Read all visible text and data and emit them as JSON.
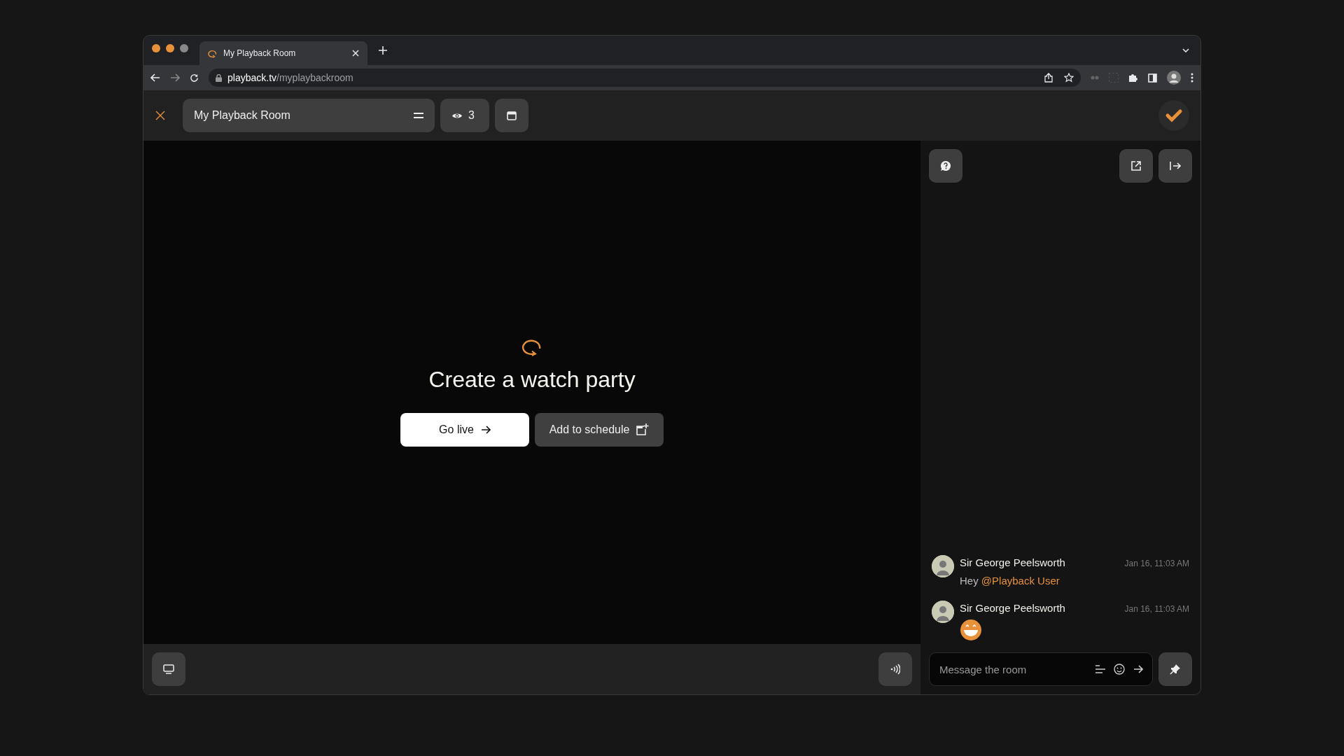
{
  "browser": {
    "tab_title": "My Playback Room",
    "url_domain": "playback.tv",
    "url_path": "/myplaybackroom"
  },
  "room": {
    "name": "My Playback Room",
    "viewers": "3"
  },
  "hero": {
    "title": "Create a watch party",
    "primary_button": "Go live",
    "secondary_button": "Add to schedule"
  },
  "chat": {
    "messages": [
      {
        "kind": "text",
        "author": "Sir George Peelsworth",
        "time": "Jan 16, 11:03 AM",
        "text": "Hey ",
        "mention": "@Playback User"
      },
      {
        "kind": "emoji",
        "author": "Sir George Peelsworth",
        "time": "Jan 16, 11:03 AM"
      }
    ],
    "input": {
      "placeholder": "Message the room"
    }
  }
}
